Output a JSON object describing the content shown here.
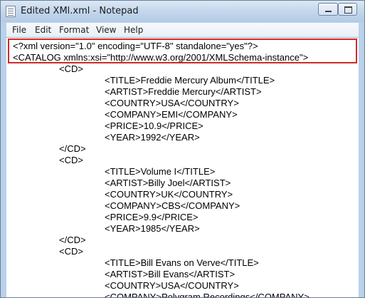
{
  "window": {
    "title": "Edited XMl.xml - Notepad"
  },
  "menu": [
    "File",
    "Edit",
    "Format",
    "View",
    "Help"
  ],
  "lines": [
    "<?xml version=\"1.0\" encoding=\"UTF-8\" standalone=\"yes\"?>",
    "<CATALOG xmlns:xsi=\"http://www.w3.org/2001/XMLSchema-instance\">",
    "<CD>",
    "<TITLE>Freddie Mercury Album</TITLE>",
    "<ARTIST>Freddie Mercury</ARTIST>",
    "<COUNTRY>USA</COUNTRY>",
    "<COMPANY>EMI</COMPANY>",
    "<PRICE>10.9</PRICE>",
    "<YEAR>1992</YEAR>",
    "</CD>",
    "<CD>",
    "<TITLE>Volume I</TITLE>",
    "<ARTIST>Billy Joel</ARTIST>",
    "<COUNTRY>UK</COUNTRY>",
    "<COMPANY>CBS</COMPANY>",
    "<PRICE>9.9</PRICE>",
    "<YEAR>1985</YEAR>",
    "</CD>",
    "<CD>",
    "<TITLE>Bill Evans on Verve</TITLE>",
    "<ARTIST>Bill Evans</ARTIST>",
    "<COUNTRY>USA</COUNTRY>",
    "<COMPANY>Polygram Recordings</COMPANY>"
  ]
}
